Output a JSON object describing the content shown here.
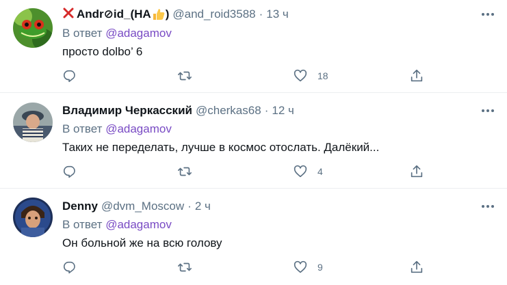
{
  "colors": {
    "secondary": "#5b7083",
    "mention": "#794bc4",
    "divider": "#ebeef0",
    "text": "#0f1419"
  },
  "tweets": [
    {
      "name_prefix_icon": "red-cross-icon",
      "name": "Andr⊘id_(HA",
      "name_suffix_icon": "thumbs-up-icon",
      "name_close": ")",
      "handle": "@and_roid3588",
      "dot": "·",
      "time": "13 ч",
      "reply_label": "В ответ",
      "reply_mention": "@adagamov",
      "text": "просто dolbo’ 6",
      "reply_count": "",
      "retweet_count": "",
      "like_count": "18"
    },
    {
      "name": "Владимир Черкасский",
      "handle": "@cherkas68",
      "dot": "·",
      "time": "12 ч",
      "reply_label": "В ответ",
      "reply_mention": "@adagamov",
      "text": "Таких не переделать, лучше в космос отослать. Далёкий...",
      "reply_count": "",
      "retweet_count": "",
      "like_count": "4"
    },
    {
      "name": "Denny",
      "handle": "@dvm_Moscow",
      "dot": "·",
      "time": "2 ч",
      "reply_label": "В ответ",
      "reply_mention": "@adagamov",
      "text": "Он больной же на всю голову",
      "reply_count": "",
      "retweet_count": "",
      "like_count": "9"
    }
  ]
}
